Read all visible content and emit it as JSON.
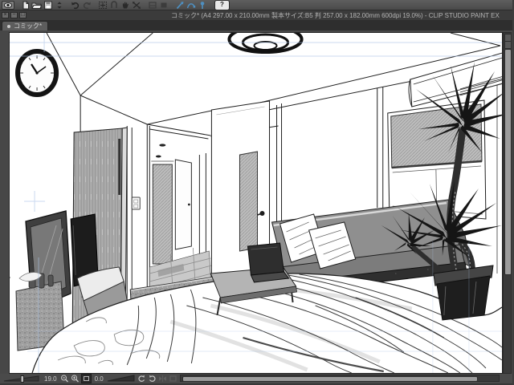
{
  "window": {
    "title": "コミック* (A4 297.00 x 210.00mm 製本サイズ:B5 判 257.00 x 182.00mm 600dpi 19.0%)  - CLIP STUDIO PAINT EX",
    "app_name": "CLIP STUDIO PAINT EX",
    "controls": [
      {
        "name": "close",
        "glyph": "×"
      },
      {
        "name": "minimize",
        "glyph": "−"
      },
      {
        "name": "maximize",
        "glyph": "□"
      }
    ]
  },
  "command_bar": {
    "icons": [
      "eye-icon",
      "new-canvas-icon",
      "open-icon",
      "save-icon",
      "stepper-icon",
      "undo-icon",
      "redo-icon",
      "transform-icon",
      "snap-icon",
      "hand-icon",
      "rotate-canvas-icon",
      "disabled-icon-1",
      "disabled-icon-2",
      "object-tool-icon",
      "correction-tool-icon",
      "pin-tool-icon",
      "help-icon"
    ],
    "help_label": "?"
  },
  "tab": {
    "label": "コミック*",
    "modified": true
  },
  "document": {
    "name": "コミック",
    "paper": "A4 297.00 x 210.00mm",
    "finish_size": "製本サイズ:B5 判 257.00 x 182.00mm",
    "resolution": "600dpi"
  },
  "nav": {
    "zoom_value": "19.0",
    "rotation_value": "0.0",
    "buttons": [
      "zoom-slider",
      "zoom-out-icon",
      "zoom-in-icon",
      "fit-screen-icon",
      "rotation-slider",
      "rotate-ccw-icon",
      "rotate-cw-icon",
      "flip-disabled-icon",
      "reset-disabled-icon"
    ]
  },
  "colors": {
    "pasteboard": "#474747",
    "command_bar": "#525252",
    "title_bar": "#3b3b3b",
    "tab_bar": "#2e2e2e",
    "canvas": "#ffffff",
    "guide_blue": "#a9c2e6",
    "tool_accent_blue": "#4e8fc0",
    "scroll_thumb": "#9c9c9c",
    "ink": "#1f1f1f"
  }
}
